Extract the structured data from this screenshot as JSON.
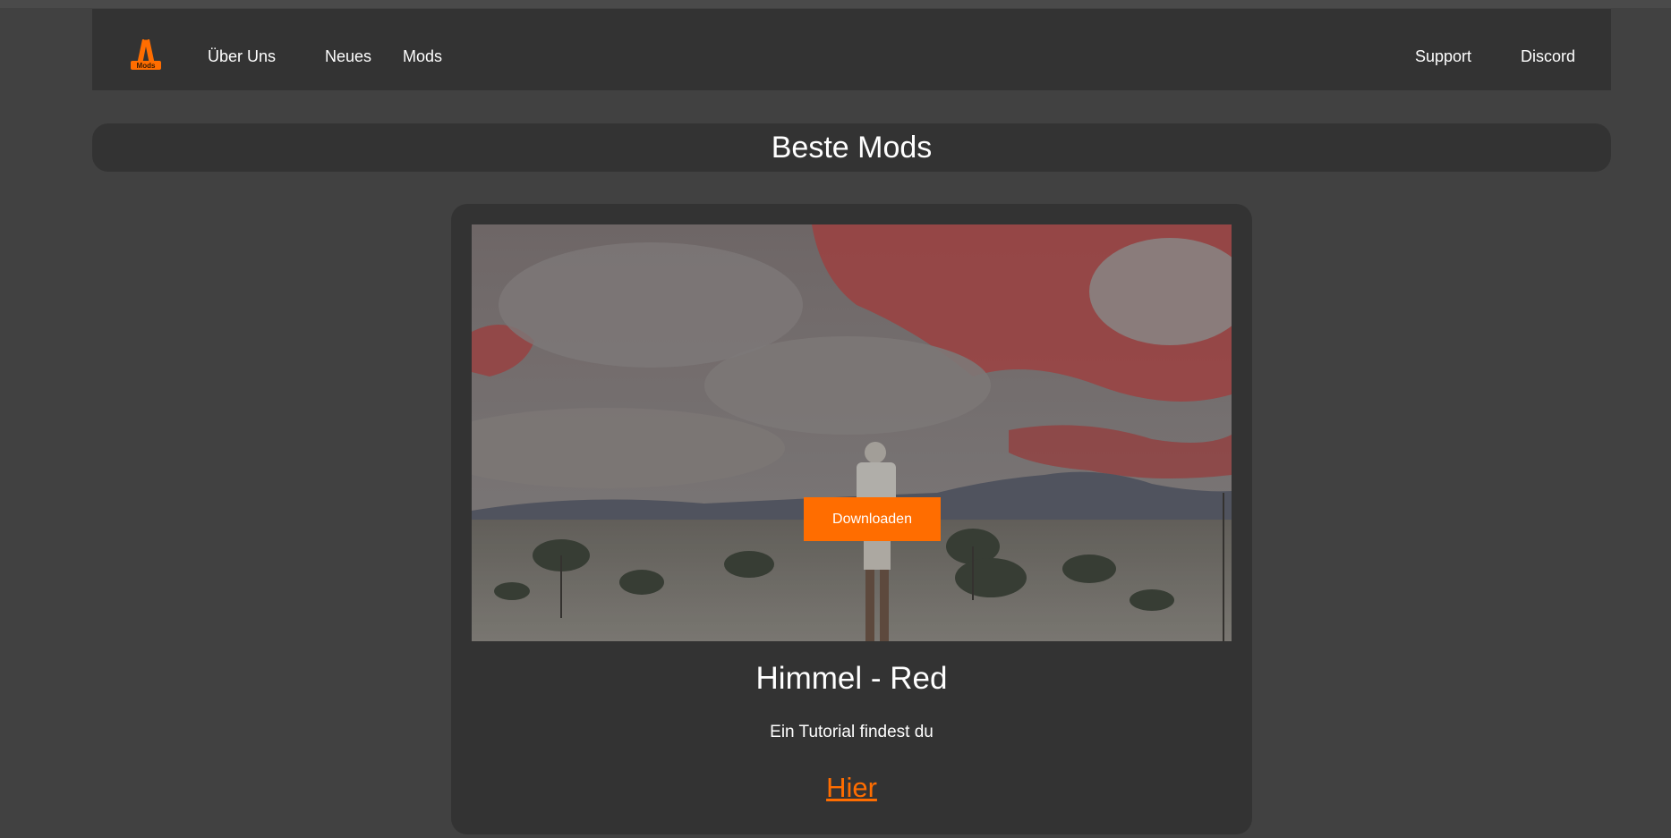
{
  "logo": {
    "text": "Mods",
    "icon": "mods-logo-icon"
  },
  "nav": {
    "left": [
      "Über Uns",
      "Neues",
      "Mods"
    ],
    "right": [
      "Support",
      "Discord"
    ]
  },
  "banner": {
    "title": "Beste Mods"
  },
  "card": {
    "image_alt": "Himmel - Red preview",
    "download_label": "Downloaden",
    "title": "Himmel - Red",
    "description": "Ein Tutorial findest du",
    "link_label": "Hier"
  },
  "colors": {
    "background": "#414141",
    "panel": "#333333",
    "accent": "#ff6d00",
    "text": "#ffffff"
  }
}
